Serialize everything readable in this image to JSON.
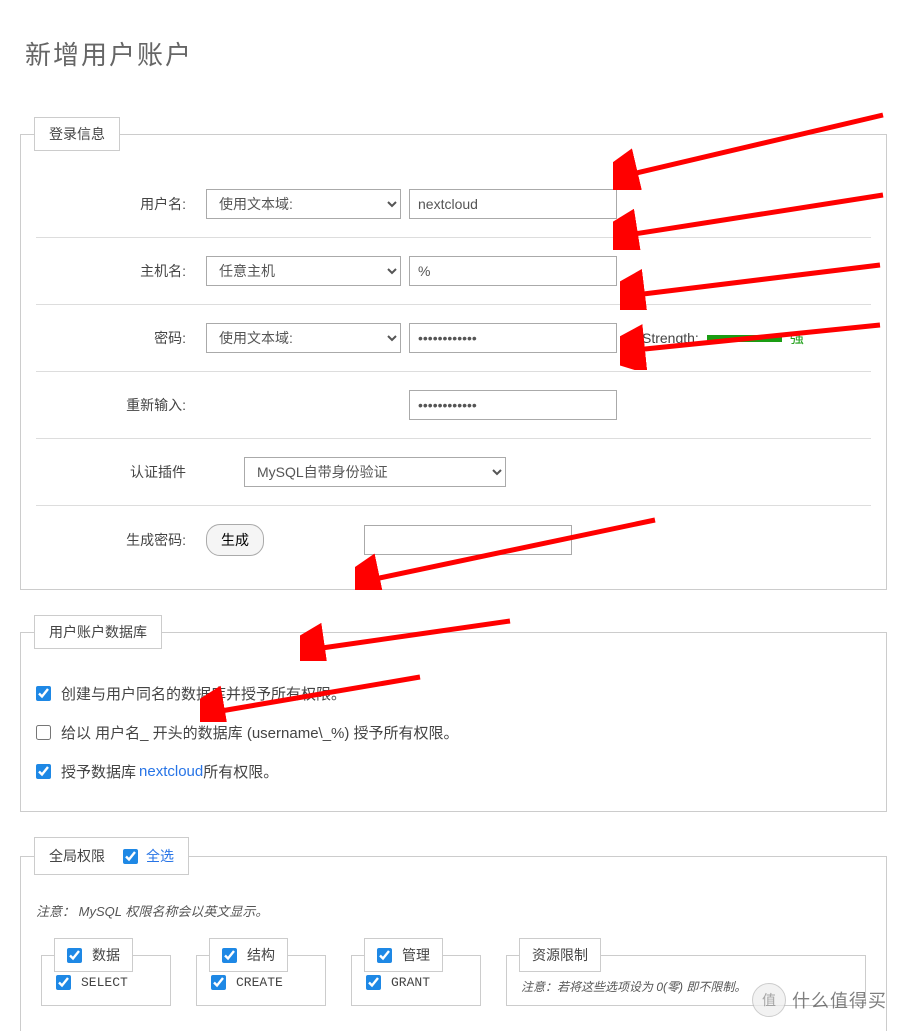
{
  "title": "新增用户账户",
  "fieldsets": {
    "login": {
      "legend": "登录信息",
      "username_label": "用户名:",
      "username_select": "使用文本域:",
      "username_value": "nextcloud",
      "host_label": "主机名:",
      "host_select": "任意主机",
      "host_value": "%",
      "password_label": "密码:",
      "password_select": "使用文本域:",
      "password_value": "••••••••••••",
      "strength_label": "Strength:",
      "strength_text": "强",
      "retype_label": "重新输入:",
      "retype_value": "••••••••••••",
      "auth_label": "认证插件",
      "auth_value": "MySQL自带身份验证",
      "generate_label": "生成密码:",
      "generate_button": "生成"
    },
    "database": {
      "legend": "用户账户数据库",
      "opt1": "创建与用户同名的数据库并授予所有权限。",
      "opt2": "给以 用户名_ 开头的数据库 (username\\_%) 授予所有权限。",
      "opt3_prefix": "授予数据库 ",
      "opt3_link": "nextcloud",
      "opt3_suffix": " 所有权限。"
    },
    "global": {
      "legend": "全局权限",
      "select_all": "全选",
      "note": "注意： MySQL 权限名称会以英文显示。",
      "data_label": "数据",
      "structure_label": "结构",
      "admin_label": "管理",
      "resource_label": "资源限制",
      "resource_note": "注意：若将这些选项设为 0(零) 即不限制。",
      "priv_select": "SELECT",
      "priv_create": "CREATE",
      "priv_grant": "GRANT"
    }
  },
  "watermark": {
    "char": "值",
    "text": "什么值得买"
  }
}
